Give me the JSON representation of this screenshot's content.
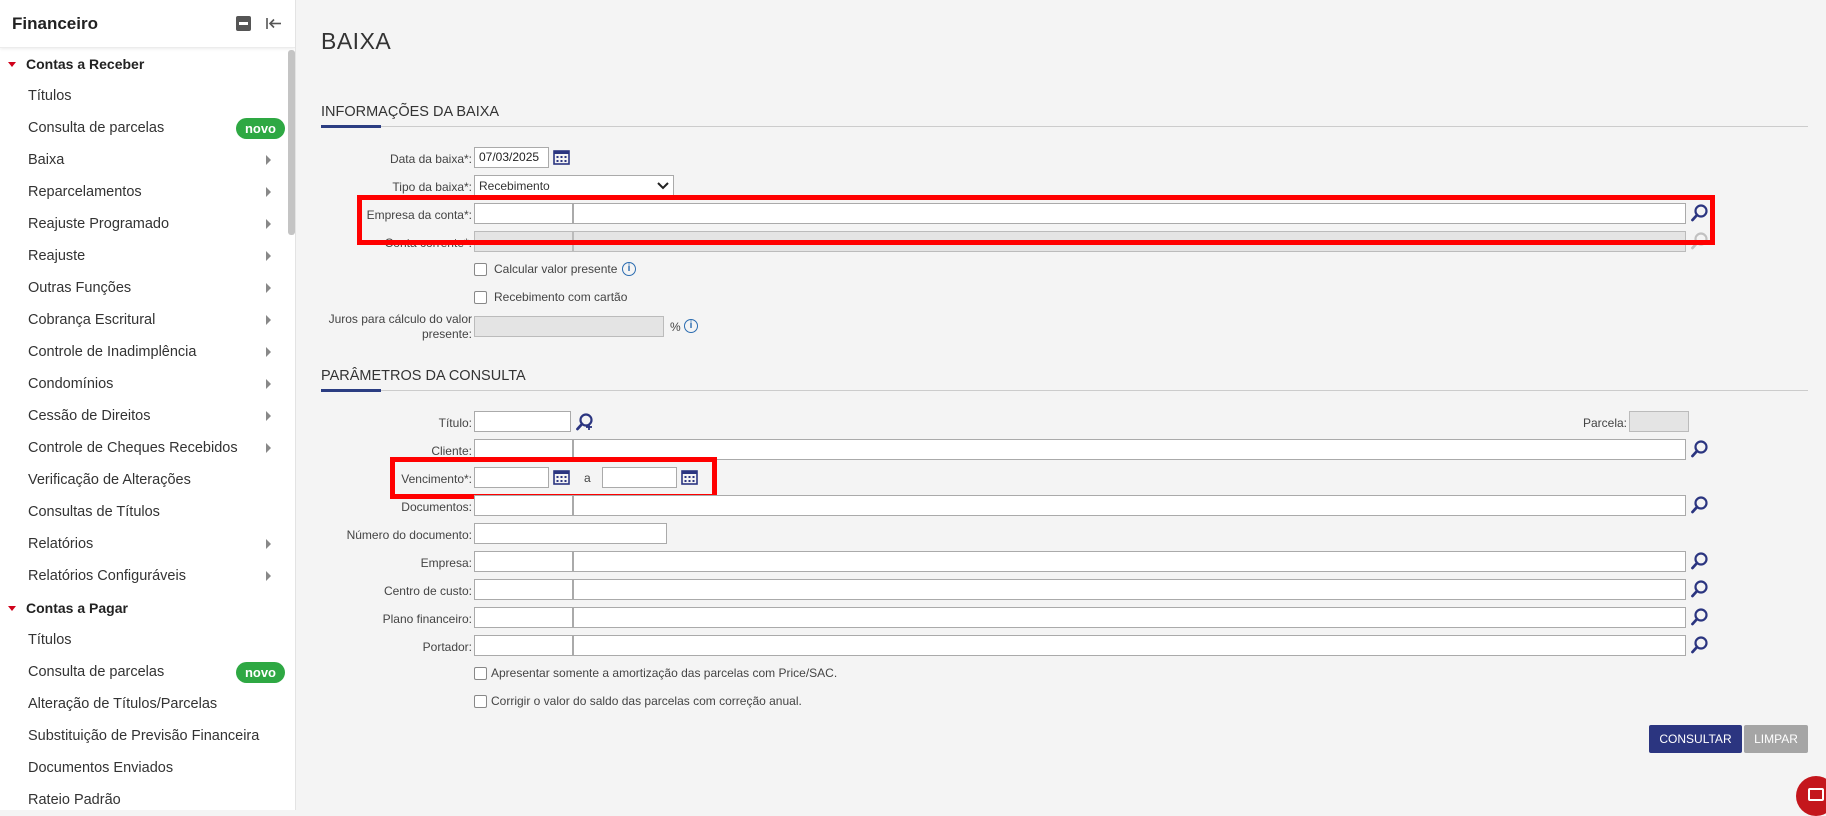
{
  "sidebar": {
    "title": "Financeiro",
    "sections": [
      {
        "label": "Contas a Receber",
        "items": [
          {
            "label": "Títulos",
            "arrow": false,
            "badge": ""
          },
          {
            "label": "Consulta de parcelas",
            "arrow": false,
            "badge": "novo"
          },
          {
            "label": "Baixa",
            "arrow": true,
            "badge": ""
          },
          {
            "label": "Reparcelamentos",
            "arrow": true,
            "badge": ""
          },
          {
            "label": "Reajuste Programado",
            "arrow": true,
            "badge": ""
          },
          {
            "label": "Reajuste",
            "arrow": true,
            "badge": ""
          },
          {
            "label": "Outras Funções",
            "arrow": true,
            "badge": ""
          },
          {
            "label": "Cobrança Escritural",
            "arrow": true,
            "badge": ""
          },
          {
            "label": "Controle de Inadimplência",
            "arrow": true,
            "badge": ""
          },
          {
            "label": "Condomínios",
            "arrow": true,
            "badge": ""
          },
          {
            "label": "Cessão de Direitos",
            "arrow": true,
            "badge": ""
          },
          {
            "label": "Controle de Cheques Recebidos",
            "arrow": true,
            "badge": ""
          },
          {
            "label": "Verificação de Alterações",
            "arrow": false,
            "badge": ""
          },
          {
            "label": "Consultas de Títulos",
            "arrow": false,
            "badge": ""
          },
          {
            "label": "Relatórios",
            "arrow": true,
            "badge": ""
          },
          {
            "label": "Relatórios Configuráveis",
            "arrow": true,
            "badge": ""
          }
        ]
      },
      {
        "label": "Contas a Pagar",
        "items": [
          {
            "label": "Títulos",
            "arrow": false,
            "badge": ""
          },
          {
            "label": "Consulta de parcelas",
            "arrow": false,
            "badge": "novo"
          },
          {
            "label": "Alteração de Títulos/Parcelas",
            "arrow": false,
            "badge": ""
          },
          {
            "label": "Substituição de Previsão Financeira",
            "arrow": false,
            "badge": ""
          },
          {
            "label": "Documentos Enviados",
            "arrow": false,
            "badge": ""
          },
          {
            "label": "Rateio Padrão",
            "arrow": false,
            "badge": ""
          }
        ]
      }
    ]
  },
  "page": {
    "title": "BAIXA"
  },
  "info_section": {
    "heading": "INFORMAÇÕES DA BAIXA",
    "data_baixa_label": "Data da baixa*:",
    "data_baixa_value": "07/03/2025",
    "tipo_baixa_label": "Tipo da baixa*:",
    "tipo_baixa_value": "Recebimento",
    "empresa_conta_label": "Empresa da conta*:",
    "conta_corrente_label": "Conta corrente*:",
    "calcular_vp_label": "Calcular valor presente",
    "recebimento_cartao_label": "Recebimento com cartão",
    "juros_label_1": "Juros para cálculo do valor",
    "juros_label_2": "presente:",
    "juros_unit": "%"
  },
  "params_section": {
    "heading": "PARÂMETROS DA CONSULTA",
    "titulo_label": "Título:",
    "parcela_label": "Parcela:",
    "cliente_label": "Cliente:",
    "vencimento_label": "Vencimento*:",
    "vencimento_sep": "a",
    "documentos_label": "Documentos:",
    "numero_documento_label": "Número do documento:",
    "empresa_label": "Empresa:",
    "centro_custo_label": "Centro de custo:",
    "plano_financeiro_label": "Plano financeiro:",
    "portador_label": "Portador:",
    "amortizacao_label": "Apresentar somente a amortização das parcelas com Price/SAC.",
    "correcao_label": "Corrigir o valor do saldo das parcelas com correção anual."
  },
  "actions": {
    "consultar": "CONSULTAR",
    "limpar": "LIMPAR"
  },
  "colors": {
    "accent": "#2b3580",
    "badge": "#2ea843",
    "highlight": "#ff0000",
    "caret": "#d0021b"
  }
}
